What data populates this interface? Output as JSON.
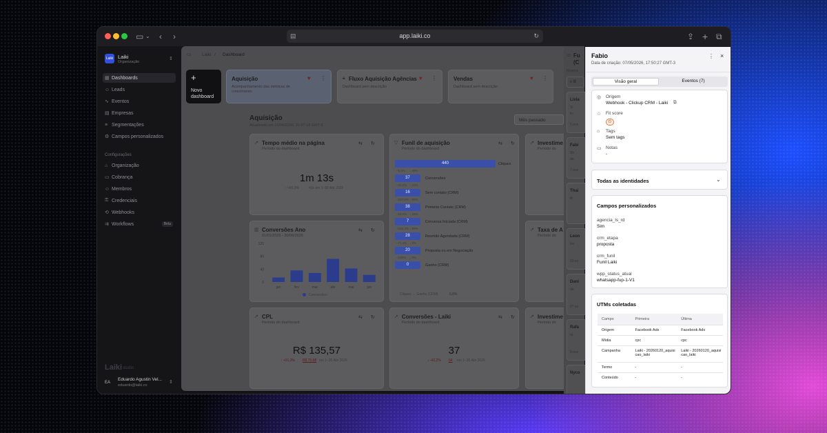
{
  "browser": {
    "url": "app.laiki.co"
  },
  "org": {
    "logo": "Laiki",
    "name": "Laiki",
    "subtitle": "Organização"
  },
  "sidebar": {
    "items": [
      {
        "label": "Dashboards",
        "icon": "grid-icon",
        "active": true
      },
      {
        "label": "Leads",
        "icon": "users-icon"
      },
      {
        "label": "Eventos",
        "icon": "activity-icon"
      },
      {
        "label": "Empresas",
        "icon": "building-icon"
      },
      {
        "label": "Segmentações",
        "icon": "filter-icon"
      },
      {
        "label": "Campos personalizados",
        "icon": "sliders-icon"
      }
    ],
    "config_heading": "Configurações",
    "config_items": [
      {
        "label": "Organização",
        "icon": "org-icon"
      },
      {
        "label": "Cobrança",
        "icon": "card-icon"
      },
      {
        "label": "Membros",
        "icon": "members-icon"
      },
      {
        "label": "Credenciais",
        "icon": "key-icon"
      },
      {
        "label": "Webhooks",
        "icon": "webhook-icon"
      },
      {
        "label": "Workflows",
        "icon": "workflow-icon",
        "badge": "Beta"
      }
    ],
    "footer_brand": "Laiki",
    "footer_brand_suffix": "studio",
    "user": {
      "initials": "EA",
      "name": "Eduardo Agustin Vel...",
      "email": "eduardo@laiki.co"
    }
  },
  "breadcrumb": {
    "root": "Laiki",
    "current": "Dashboard"
  },
  "dashboards": {
    "new_label_1": "Novo",
    "new_label_2": "dashboard",
    "new_plus": "+",
    "tabs": [
      {
        "title": "Aquisição",
        "desc": "Acompanhamento das métricas de",
        "desc2": "crescimento"
      },
      {
        "title": "Fluxo Aquisição Agências",
        "desc": "Dashboard sem descrição"
      },
      {
        "title": "Vendas",
        "desc": "Dashboard sem descrição"
      }
    ]
  },
  "section": {
    "title": "Aquisição",
    "updated": "Atualizado em 16/06/2026, 21:07:18 GMT-3",
    "period": "Mês passado"
  },
  "cards": {
    "tempo": {
      "title": "Tempo médio na página",
      "sub": "Período do dashboard",
      "value": "1m 13s",
      "delta": "↑ +65,3%",
      "compare": "43s em 1–30 Abr 2026"
    },
    "conversoes_ano": {
      "title": "Conversões Ano",
      "sub": "01/01/2026 - 30/06/2026",
      "legend": "Conversões"
    },
    "cpl": {
      "title": "CPL",
      "sub": "Período do dashboard",
      "value": "R$ 135,57",
      "delta": "↑ +91,3%",
      "prev": "R$ 70,88",
      "compare": "em 1–30 Abr 2026"
    },
    "funil": {
      "title": "Funil de aquisição",
      "sub": "Período do dashboard",
      "footer_label": "Cliques → Ganho (CRM)",
      "footer_value": "0,0%"
    },
    "conv_laiki": {
      "title": "Conversões - Laiki",
      "sub": "Período do dashboard",
      "value": "37",
      "delta": "↓ -42,2%",
      "prev": "64",
      "compare": "em 1–30 Abr 2026"
    },
    "inv1": {
      "title": "Investime",
      "sub": "Período do"
    },
    "taxa": {
      "title": "Taxa de A",
      "sub": "Período do"
    },
    "inv2": {
      "title": "Investime",
      "sub": "Período do"
    }
  },
  "chart_data": {
    "type": "bar",
    "categories": [
      "jan",
      "fev",
      "mar",
      "abr",
      "mai",
      "jun"
    ],
    "series": [
      {
        "name": "Conversões",
        "values": [
          14,
          36,
          28,
          72,
          42,
          22
        ]
      }
    ],
    "yticks": [
      0,
      40,
      80,
      120
    ],
    "ylim": [
      0,
      120
    ]
  },
  "funnel": {
    "steps": [
      {
        "value": "440",
        "label": "Cliques"
      },
      {
        "drop": "–5,4%",
        "drop2": "↓ 40%",
        "value": "37",
        "label": "Conversões"
      },
      {
        "drop": "–43,2%",
        "drop2": "↓ 21%",
        "value": "16",
        "label": "Sem contato (CRM)"
      },
      {
        "drop": "–237,5%",
        "drop2": "↓ 60%",
        "value": "38",
        "label": "Primeiro Contato (CRM)"
      },
      {
        "drop": "–15,4%",
        "drop2": "↓ 15%",
        "value": "7",
        "label": "Conversa Iniciada (CRM)"
      },
      {
        "drop": "+433,3%",
        "drop2": "↓ 20%",
        "value": "28",
        "label": "Reunião Agendada (CRM)"
      },
      {
        "drop": "–71,4%",
        "drop2": "↓ 0%",
        "value": "20",
        "label": "Proposta ou em Negociação"
      },
      {
        "drop": "–100%",
        "drop2": "↓ 0%",
        "value": "0",
        "label": "Ganho (CRM)"
      }
    ]
  },
  "leads": {
    "title": "Fu",
    "title2": "(C",
    "sub": "Mostra",
    "search": "B",
    "items": [
      {
        "name": "Livia",
        "meta": "Si",
        "meta2": "liv",
        "count": "5 eve"
      },
      {
        "name": "Fabi",
        "meta": "Sh",
        "meta2": "da",
        "count": "7 eve"
      },
      {
        "name": "Thai",
        "meta": "th",
        "count": ""
      },
      {
        "name": "Leon",
        "meta": "lec",
        "count": "33 ev"
      },
      {
        "name": "Dani",
        "meta": "da",
        "count": "97 ev"
      },
      {
        "name": "Rafa",
        "meta": "ra",
        "count": "9 eve"
      },
      {
        "name": "Nyco",
        "meta": "",
        "count": ""
      }
    ]
  },
  "panel": {
    "name": "Fabio",
    "created": "Data de criação: 07/05/2026, 17:50:27 GMT-3",
    "tabs": [
      {
        "label": "Visão geral",
        "active": true
      },
      {
        "label": "Eventos (7)"
      }
    ],
    "origem_label": "Origem",
    "origem_value": "Webhook - Clickup CRM - Laiki",
    "fit_label": "Fit score",
    "fit_value": "D",
    "tags_label": "Tags",
    "tags_value": "Sem tags",
    "notas_label": "Notas",
    "notas_value": "-",
    "identities": "Todas as identidades",
    "custom_title": "Campos personalizados",
    "custom_fields": [
      {
        "key": "agencia_ls_rd",
        "value": "Sim"
      },
      {
        "key": "crm_etapa",
        "value": "proposta"
      },
      {
        "key": "crm_funil",
        "value": "Funil Laiki"
      },
      {
        "key": "wpp_status_atual",
        "value": "whatsapp-fup-1-V1"
      }
    ],
    "utm_title": "UTMs coletadas",
    "utm_headers": [
      "Campo",
      "Primeira",
      "Última"
    ],
    "utm_rows": [
      [
        "Origem",
        "Facebook Ads",
        "Facebook Ads"
      ],
      [
        "Mídia",
        "cpc",
        "cpc"
      ],
      [
        "Campanha",
        "Laiki - 20260120_aquisicao_laiki",
        "Laiki - 20260120_aquisicao_laiki"
      ],
      [
        "Termo",
        "-",
        "-"
      ],
      [
        "Conteúdo",
        "-",
        "-"
      ]
    ]
  },
  "colors": {
    "accent": "#3a4faa",
    "tab_active": "#e6e6ea",
    "danger": "#e0352f"
  }
}
